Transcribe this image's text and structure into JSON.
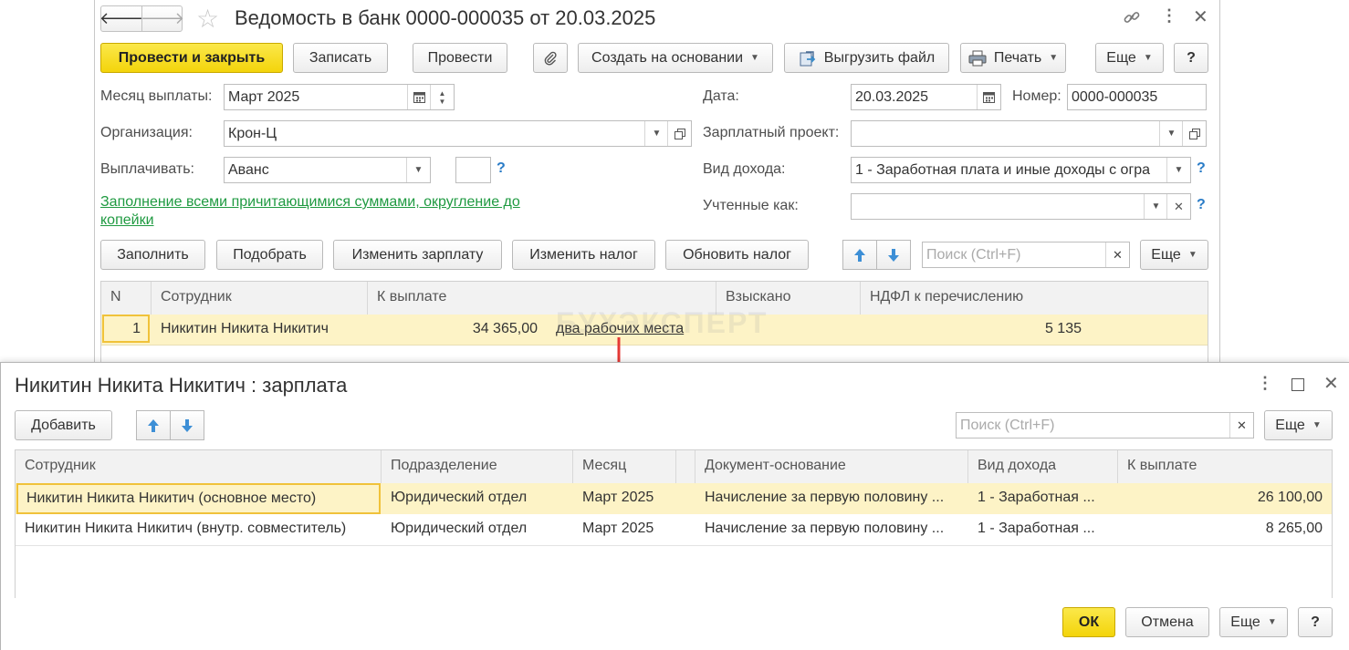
{
  "main": {
    "title": "Ведомость в банк 0000-000035 от 20.03.2025",
    "nav_back": "🡐",
    "nav_forward": "🡒",
    "toolbar": {
      "post_close": "Провести и закрыть",
      "save": "Записать",
      "post": "Провести",
      "create_based": "Создать на основании",
      "export_file": "Выгрузить файл",
      "print": "Печать",
      "more": "Еще",
      "help": "?"
    },
    "form": {
      "month_label": "Месяц выплаты:",
      "month_value": "Март 2025",
      "date_label": "Дата:",
      "date_value": "20.03.2025",
      "number_label": "Номер:",
      "number_value": "0000-000035",
      "org_label": "Организация:",
      "org_value": "Крон-Ц",
      "salary_project_label": "Зарплатный проект:",
      "salary_project_value": "",
      "pay_label": "Выплачивать:",
      "pay_value": "Аванс",
      "income_type_label": "Вид дохода:",
      "income_type_value": "1 - Заработная плата и иные доходы с огра",
      "accounted_label": "Учтенные как:",
      "accounted_value": "",
      "fill_link": "Заполнение всеми причитающимися суммами, округление до копейки",
      "help_q": "?"
    },
    "table_toolbar": {
      "fill": "Заполнить",
      "pick": "Подобрать",
      "change_salary": "Изменить зарплату",
      "change_tax": "Изменить налог",
      "update_tax": "Обновить налог",
      "search_placeholder": "Поиск (Ctrl+F)",
      "more": "Еще"
    },
    "table": {
      "headers": [
        "N",
        "Сотрудник",
        "К выплате",
        "Взыскано",
        "НДФЛ к перечислению"
      ],
      "rows": [
        {
          "n": "1",
          "employee": "Никитин Никита Никитич",
          "amount": "34 365,00",
          "note": "два рабочих места",
          "withheld": "",
          "ndfl": "5 135"
        }
      ]
    },
    "watermark": "БУХЭКСПЕРТ"
  },
  "dialog": {
    "title": "Никитин Никита Никитич : зарплата",
    "add": "Добавить",
    "search_placeholder": "Поиск (Ctrl+F)",
    "more": "Еще",
    "headers": [
      "Сотрудник",
      "Подразделение",
      "Месяц",
      "",
      "Документ-основание",
      "Вид дохода",
      "К выплате"
    ],
    "rows": [
      {
        "employee": "Никитин Никита Никитич (основное место)",
        "dept": "Юридический отдел",
        "month": "Март 2025",
        "doc": "Начисление за первую половину ...",
        "income": "1 - Заработная ...",
        "amount": "26 100,00"
      },
      {
        "employee": "Никитин Никита Никитич (внутр. совместитель)",
        "dept": "Юридический отдел",
        "month": "Март 2025",
        "doc": "Начисление за первую половину ...",
        "income": "1 - Заработная ...",
        "amount": "8 265,00"
      }
    ],
    "ok": "ОК",
    "cancel": "Отмена",
    "help": "?"
  },
  "colors": {
    "primary_button": "#f3d40b",
    "link_green": "#1f9a41",
    "selected_row": "#fdf3c6",
    "arrow_red": "#e53935",
    "help_blue": "#2a7cc7"
  }
}
